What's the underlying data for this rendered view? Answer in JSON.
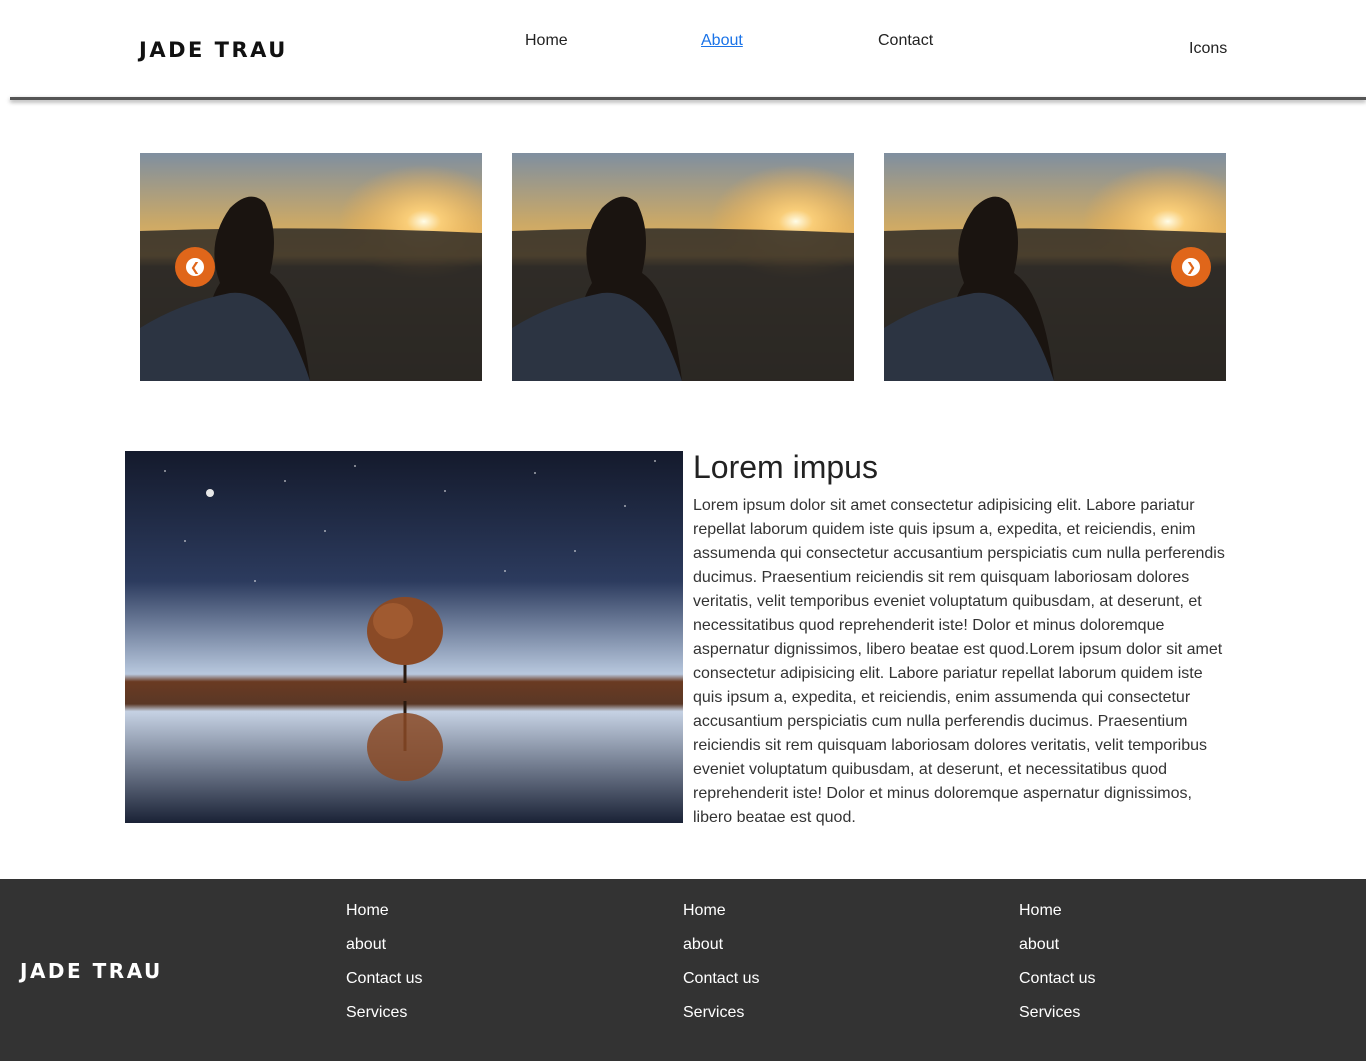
{
  "header": {
    "brand": "JADE TRAU",
    "nav": [
      {
        "label": "Home"
      },
      {
        "label": "About"
      },
      {
        "label": "Contact"
      }
    ],
    "icons_label": "Icons"
  },
  "carousel": {
    "prev_icon": "chevron-left-icon",
    "next_icon": "chevron-right-icon",
    "accent_color": "#e0661a"
  },
  "feature": {
    "title": "Lorem impus",
    "body": "Lorem ipsum dolor sit amet consectetur adipisicing elit. Labore pariatur repellat laborum quidem iste quis ipsum a, expedita, et reiciendis, enim assumenda qui consectetur accusantium perspiciatis cum nulla perferendis ducimus. Praesentium reiciendis sit rem quisquam laboriosam dolores veritatis, velit temporibus eveniet voluptatum quibusdam, at deserunt, et necessitatibus quod reprehenderit iste! Dolor et minus doloremque aspernatur dignissimos, libero beatae est quod.Lorem ipsum dolor sit amet consectetur adipisicing elit. Labore pariatur repellat laborum quidem iste quis ipsum a, expedita, et reiciendis, enim assumenda qui consectetur accusantium perspiciatis cum nulla perferendis ducimus. Praesentium reiciendis sit rem quisquam laboriosam dolores veritatis, velit temporibus eveniet voluptatum quibusdam, at deserunt, et necessitatibus quod reprehenderit iste! Dolor et minus doloremque aspernatur dignissimos, libero beatae est quod."
  },
  "footer": {
    "brand": "JADE TRAU",
    "background": "#333333",
    "columns": [
      {
        "links": [
          "Home",
          "about",
          "Contact us",
          "Services"
        ]
      },
      {
        "links": [
          "Home",
          "about",
          "Contact us",
          "Services"
        ]
      },
      {
        "links": [
          "Home",
          "about",
          "Contact us",
          "Services"
        ]
      }
    ]
  }
}
